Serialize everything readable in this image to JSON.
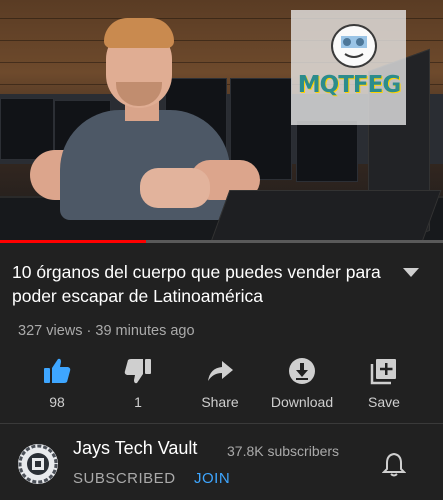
{
  "video": {
    "watermark_text": "MQTFEG",
    "progress_fraction": 0.33
  },
  "title": "10 órganos del cuerpo que puedes vender para poder escapar de Latinoamérica",
  "meta": {
    "views": "327 views",
    "separator": "·",
    "posted": "39 minutes ago"
  },
  "actions": {
    "like": {
      "icon": "thumbs-up-icon",
      "label": "98",
      "color": "#3ea6ff"
    },
    "dislike": {
      "icon": "thumbs-down-icon",
      "label": "1"
    },
    "share": {
      "icon": "share-icon",
      "label": "Share"
    },
    "download": {
      "icon": "download-icon",
      "label": "Download"
    },
    "save": {
      "icon": "add-to-playlist-icon",
      "label": "Save"
    }
  },
  "channel": {
    "name": "Jays Tech Vault",
    "subscribers": "37.8K subscribers",
    "subscribed_label": "SUBSCRIBED",
    "join_label": "JOIN",
    "bell_icon": "bell-icon"
  },
  "colors": {
    "background": "#212121",
    "accent_blue": "#3ea6ff",
    "progress_red": "#ff0000",
    "secondary_text": "#aaaaaa"
  }
}
